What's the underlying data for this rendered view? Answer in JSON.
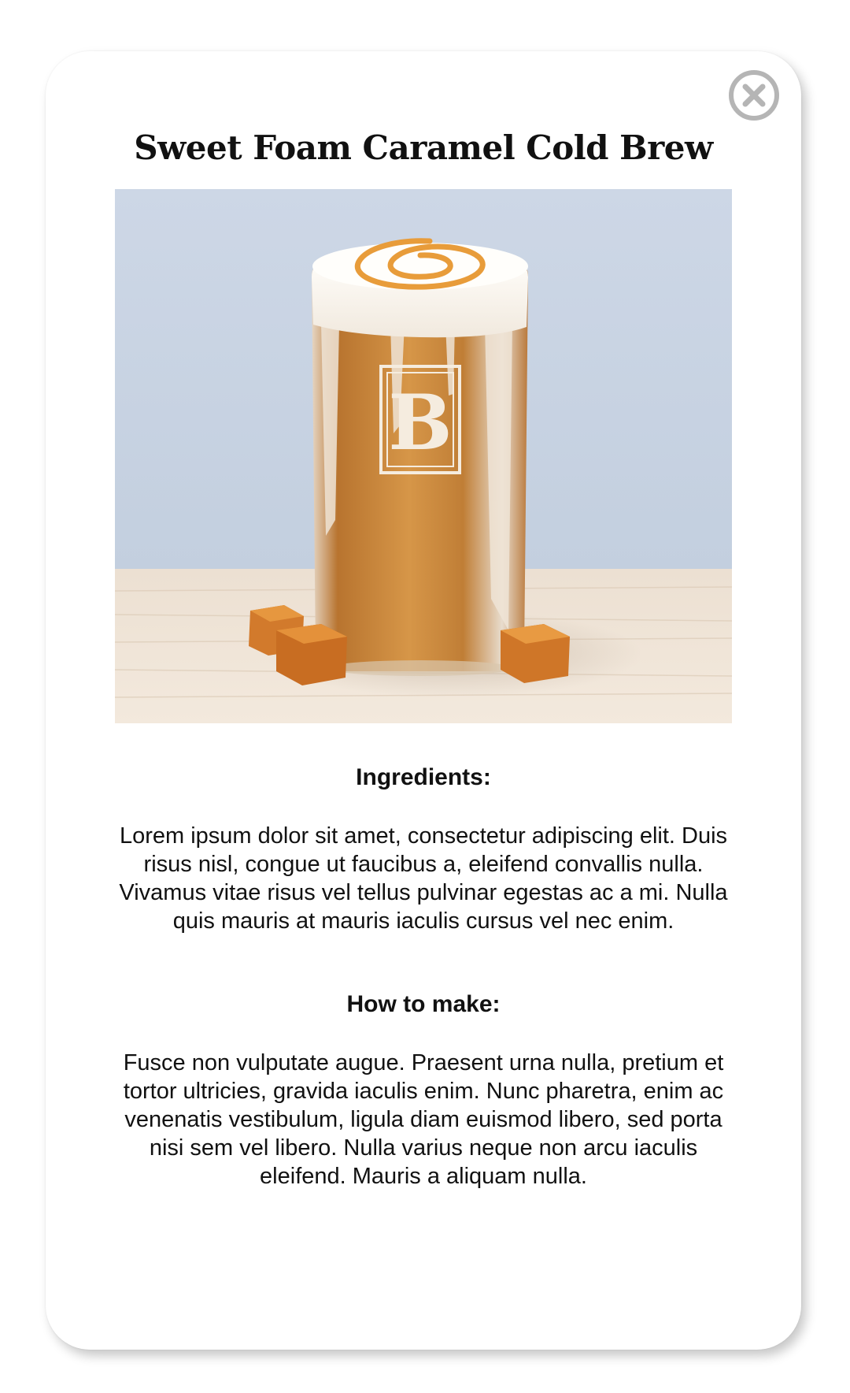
{
  "modal": {
    "title": "Sweet Foam Caramel Cold Brew",
    "close_icon": "close-circle-icon",
    "image": {
      "cup_logo_letter": "B"
    },
    "sections": {
      "ingredients": {
        "heading": "Ingredients:",
        "body": "Lorem ipsum dolor sit amet, consectetur adipiscing elit. Duis risus nisl, congue ut faucibus a, eleifend convallis nulla. Vivamus vitae risus vel tellus pulvinar egestas ac a mi. Nulla quis mauris at mauris iaculis cursus vel nec enim."
      },
      "how_to_make": {
        "heading": "How to make:",
        "body": "Fusce non vulputate augue. Praesent urna nulla, pretium et tortor ultricies, gravida iaculis enim. Nunc pharetra, enim ac venenatis vestibulum, ligula diam euismod libero, sed porta nisi sem vel libero. Nulla varius neque non arcu iaculis eleifend. Mauris a aliquam nulla."
      }
    }
  },
  "colors": {
    "card_background": "#ffffff",
    "text": "#111111",
    "close_icon": "#b5b5b5",
    "wall": "#c9d4e3",
    "table": "#eee1d2",
    "coffee": "#c98a40",
    "foam": "#fbf8f3",
    "caramel_drizzle": "#e89c3a",
    "caramel_cube": "#d27a2c"
  }
}
